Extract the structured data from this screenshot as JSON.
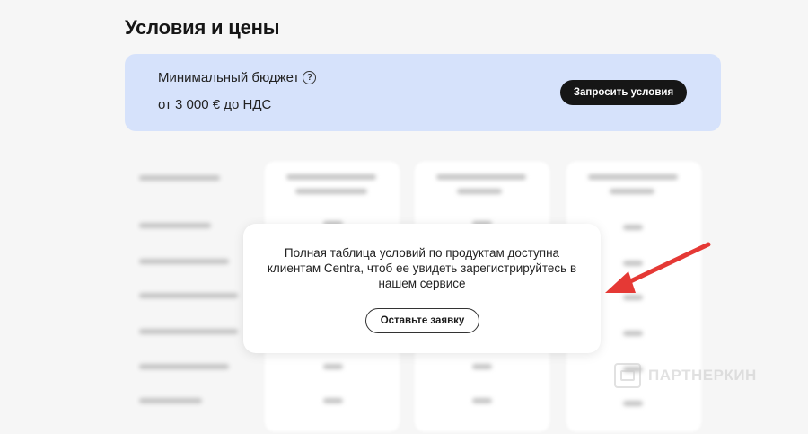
{
  "page": {
    "title": "Условия и цены"
  },
  "budget": {
    "label": "Минимальный бюджет",
    "help_icon": "?",
    "value": "от 3 000 € до НДС",
    "request_button": "Запросить условия",
    "card_color": "#d6e2fb"
  },
  "modal": {
    "message": "Полная таблица условий по продуктам доступна клиентам Centra, чтоб ее увидеть зарегистрируйтесь в нашем сервисе",
    "button": "Оставьте заявку"
  },
  "annotation": {
    "arrow_color": "#e53935"
  },
  "watermark": {
    "text": "ПАРТНЕРКИН"
  }
}
